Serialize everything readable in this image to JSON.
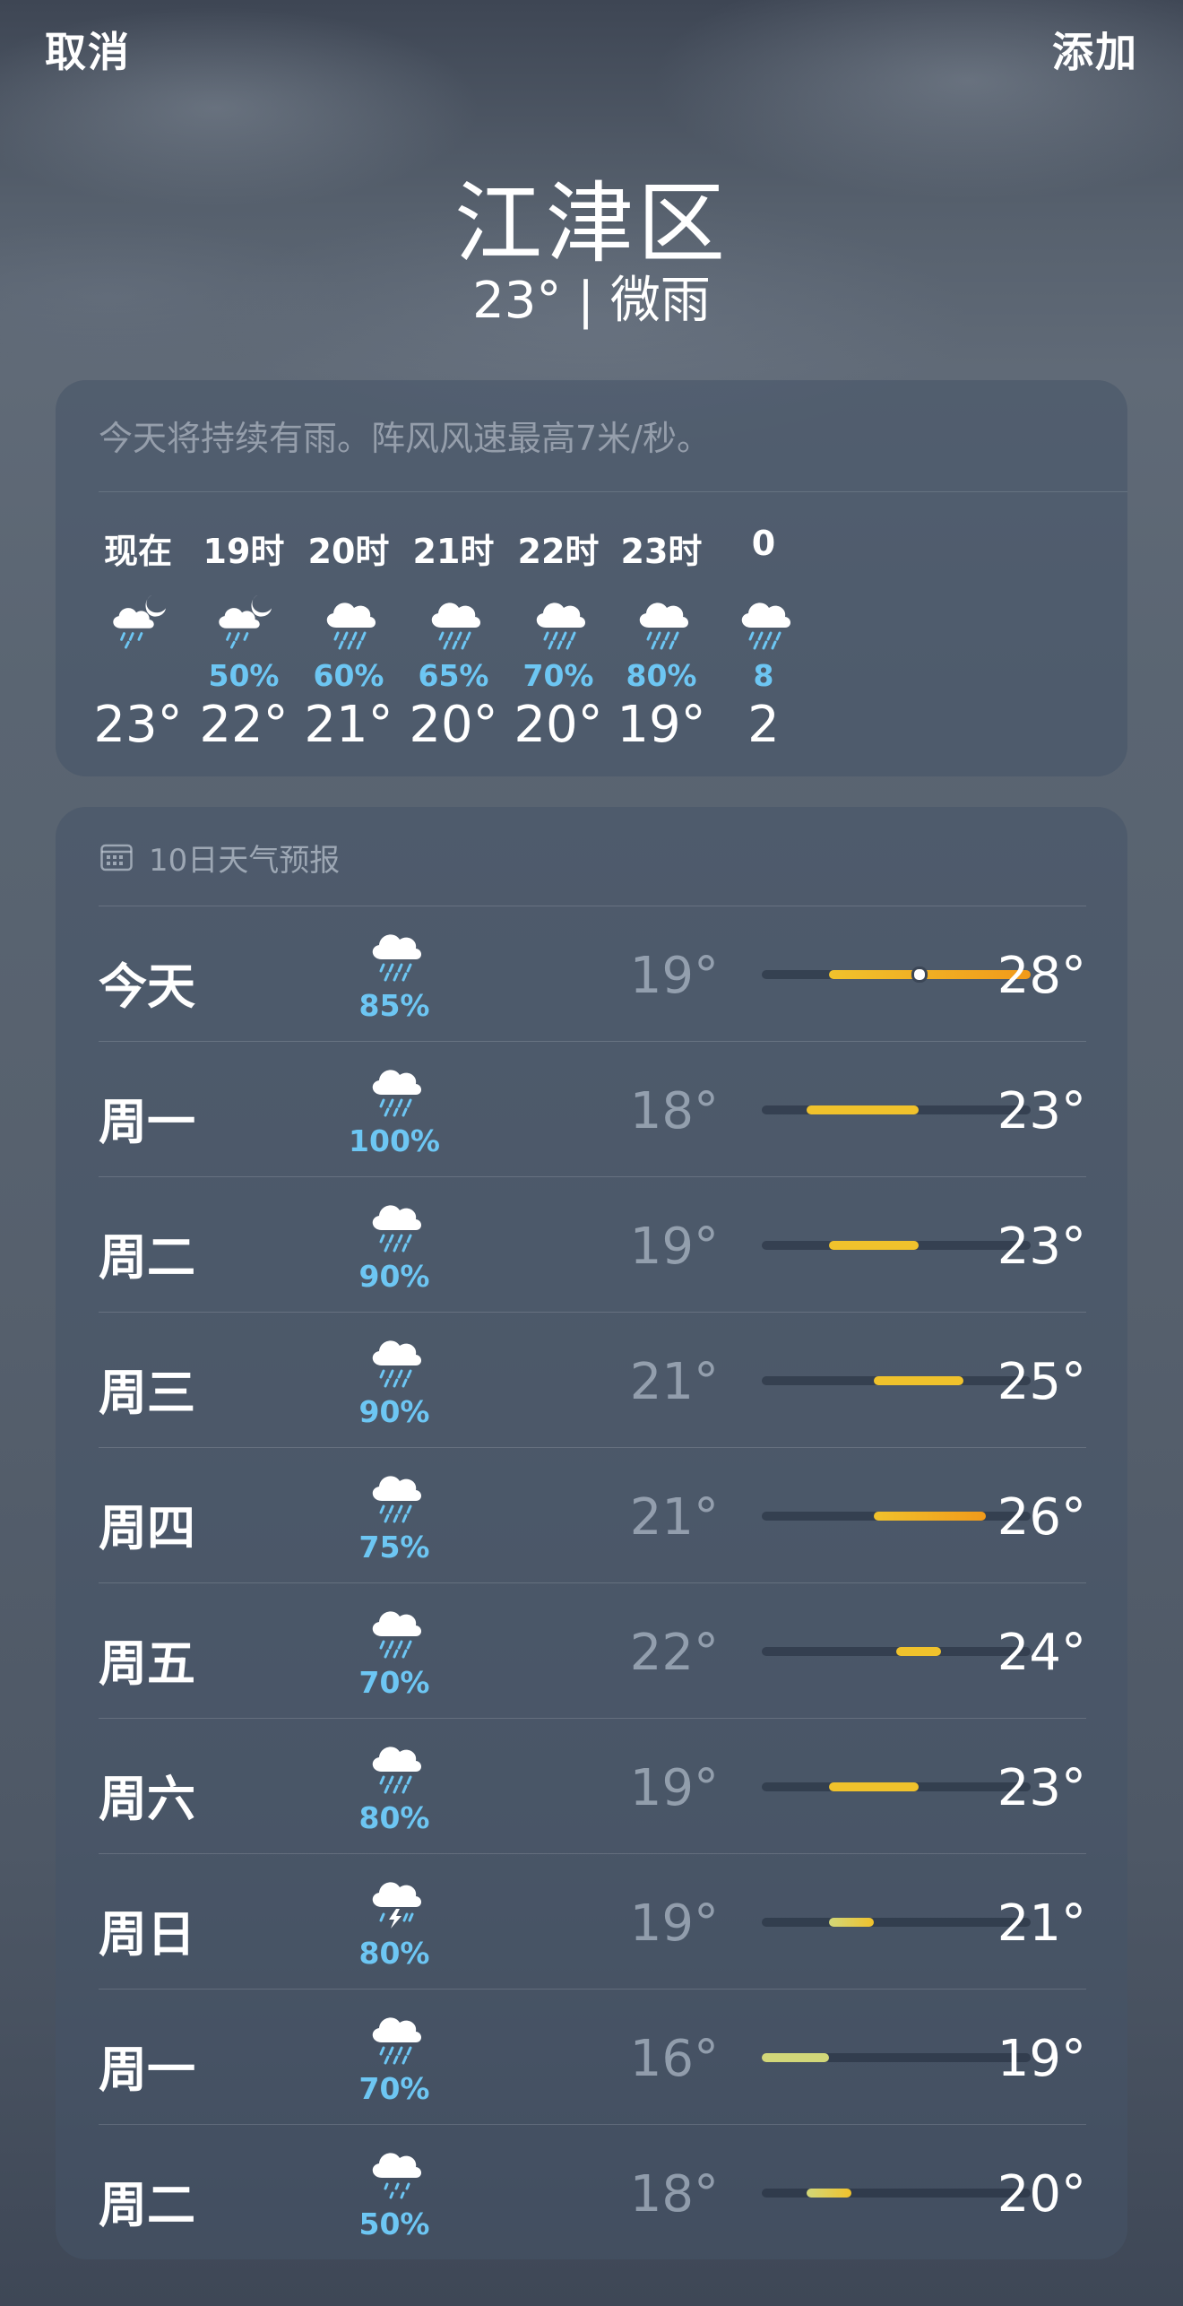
{
  "header": {
    "cancel_label": "取消",
    "add_label": "添加"
  },
  "location": {
    "name": "江津区",
    "condition": "23° | 微雨"
  },
  "hourly": {
    "summary": "今天将持续有雨。阵风风速最高7米/秒。",
    "items": [
      {
        "label": "现在",
        "icon": "cloud-moon-rain-icon",
        "precip": "",
        "temp": "23°"
      },
      {
        "label": "19时",
        "icon": "cloud-moon-rain-icon",
        "precip": "50%",
        "temp": "22°"
      },
      {
        "label": "20时",
        "icon": "cloud-rain-icon",
        "precip": "60%",
        "temp": "21°"
      },
      {
        "label": "21时",
        "icon": "cloud-rain-icon",
        "precip": "65%",
        "temp": "20°"
      },
      {
        "label": "22时",
        "icon": "cloud-rain-icon",
        "precip": "70%",
        "temp": "20°"
      },
      {
        "label": "23时",
        "icon": "cloud-rain-icon",
        "precip": "80%",
        "temp": "19°"
      },
      {
        "label": "0",
        "icon": "cloud-rain-icon",
        "precip": "8",
        "temp": "2"
      }
    ]
  },
  "daily": {
    "title": "10日天气预报",
    "range": {
      "min": 16,
      "max": 28
    },
    "current_temp": 23,
    "days": [
      {
        "day": "今天",
        "icon": "cloud-rain-icon",
        "precip": "85%",
        "low": "19°",
        "high": "28°",
        "low_value": 19,
        "high_value": 28
      },
      {
        "day": "周一",
        "icon": "cloud-rain-icon",
        "precip": "100%",
        "low": "18°",
        "high": "23°",
        "low_value": 18,
        "high_value": 23
      },
      {
        "day": "周二",
        "icon": "cloud-rain-icon",
        "precip": "90%",
        "low": "19°",
        "high": "23°",
        "low_value": 19,
        "high_value": 23
      },
      {
        "day": "周三",
        "icon": "cloud-rain-icon",
        "precip": "90%",
        "low": "21°",
        "high": "25°",
        "low_value": 21,
        "high_value": 25
      },
      {
        "day": "周四",
        "icon": "cloud-rain-icon",
        "precip": "75%",
        "low": "21°",
        "high": "26°",
        "low_value": 21,
        "high_value": 26
      },
      {
        "day": "周五",
        "icon": "cloud-rain-icon",
        "precip": "70%",
        "low": "22°",
        "high": "24°",
        "low_value": 22,
        "high_value": 24
      },
      {
        "day": "周六",
        "icon": "cloud-rain-icon",
        "precip": "80%",
        "low": "19°",
        "high": "23°",
        "low_value": 19,
        "high_value": 23
      },
      {
        "day": "周日",
        "icon": "cloud-bolt-rain-icon",
        "precip": "80%",
        "low": "19°",
        "high": "21°",
        "low_value": 19,
        "high_value": 21
      },
      {
        "day": "周一",
        "icon": "cloud-rain-icon",
        "precip": "70%",
        "low": "16°",
        "high": "19°",
        "low_value": 16,
        "high_value": 19
      },
      {
        "day": "周二",
        "icon": "cloud-drizzle-icon",
        "precip": "50%",
        "low": "18°",
        "high": "20°",
        "low_value": 18,
        "high_value": 20
      }
    ]
  },
  "colors": {
    "precip": "#6dc6f3",
    "bar_cool": "#d2d779",
    "bar_mid": "#f0c22c",
    "bar_warm": "#f19a1a"
  }
}
